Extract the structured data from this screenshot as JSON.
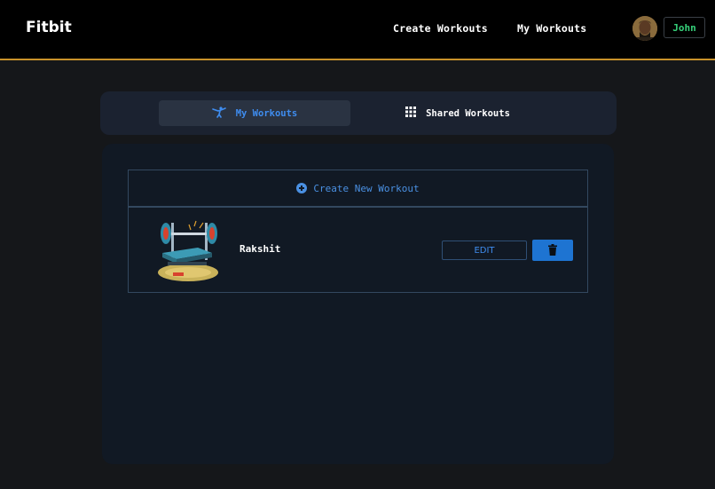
{
  "header": {
    "brand": "Fitbit",
    "nav": {
      "create_workouts": "Create Workouts",
      "my_workouts": "My Workouts"
    },
    "user_button": "John",
    "accent_color": "#c8922a"
  },
  "tabs": {
    "my_workouts": {
      "label": "My Workouts",
      "icon": "karate-kick-icon",
      "active": true
    },
    "shared_workouts": {
      "label": "Shared Workouts",
      "icon": "grid-icon",
      "active": false
    }
  },
  "create_new": {
    "label": "Create New Workout",
    "icon": "plus-circle-icon"
  },
  "workouts": [
    {
      "name": "Rakshit",
      "image": "bench-press-illustration",
      "edit_label": "EDIT",
      "delete_icon": "trash-icon"
    }
  ],
  "colors": {
    "primary": "#1e74d2",
    "link": "#3f8df0",
    "user_text": "#36d07a"
  }
}
